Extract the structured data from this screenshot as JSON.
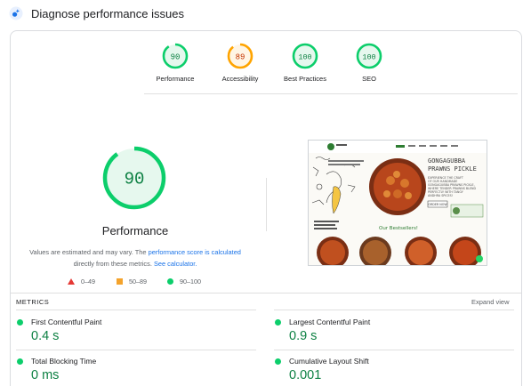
{
  "header": {
    "title": "Diagnose performance issues"
  },
  "scores": [
    {
      "label": "Performance",
      "value": "90",
      "fraction": 0.9,
      "color": "#0cce6b",
      "bg": "#e6f8ee",
      "text": "#0d8043"
    },
    {
      "label": "Accessibility",
      "value": "89",
      "fraction": 0.89,
      "color": "#ffa400",
      "bg": "#fff5e5",
      "text": "#c33300"
    },
    {
      "label": "Best Practices",
      "value": "100",
      "fraction": 1.0,
      "color": "#0cce6b",
      "bg": "#e6f8ee",
      "text": "#0d8043"
    },
    {
      "label": "SEO",
      "value": "100",
      "fraction": 1.0,
      "color": "#0cce6b",
      "bg": "#e6f8ee",
      "text": "#0d8043"
    }
  ],
  "performance": {
    "score": "90",
    "fraction": 0.9,
    "title": "Performance",
    "note_prefix": "Values are estimated and may vary. The ",
    "note_link1": "performance score is calculated",
    "note_middle": " directly from these metrics. ",
    "note_link2": "See calculator."
  },
  "legend": [
    {
      "shape": "triangle",
      "label": "0–49",
      "color": "#e53935"
    },
    {
      "shape": "square",
      "label": "50–89",
      "color": "#f4a32c"
    },
    {
      "shape": "circle",
      "label": "90–100",
      "color": "#0cce6b"
    }
  ],
  "screenshot": {
    "nav_items": [
      "",
      "",
      "",
      "",
      "",
      ""
    ],
    "headline_line1": "GONGAGUBBA",
    "headline_line2": "PRAWNS PICKLE",
    "tagline_lines": [
      "EXPERIENCE THE CRAFT",
      "OF OUR HANDMADE",
      "GONGAGUBBA PRAWNS PICKLE,",
      "WHERE TENDER PRAWNS BLEND",
      "PERFECTLY WITH TANGY",
      "ANDHRA SPICES!"
    ],
    "cta": "ORDER NOW",
    "bestsellers": "Our Bestsellers!"
  },
  "metrics": {
    "title": "METRICS",
    "expand": "Expand view",
    "items": [
      {
        "name": "First Contentful Paint",
        "value": "0.4 s"
      },
      {
        "name": "Largest Contentful Paint",
        "value": "0.9 s"
      },
      {
        "name": "Total Blocking Time",
        "value": "0 ms"
      },
      {
        "name": "Cumulative Layout Shift",
        "value": "0.001"
      }
    ]
  }
}
